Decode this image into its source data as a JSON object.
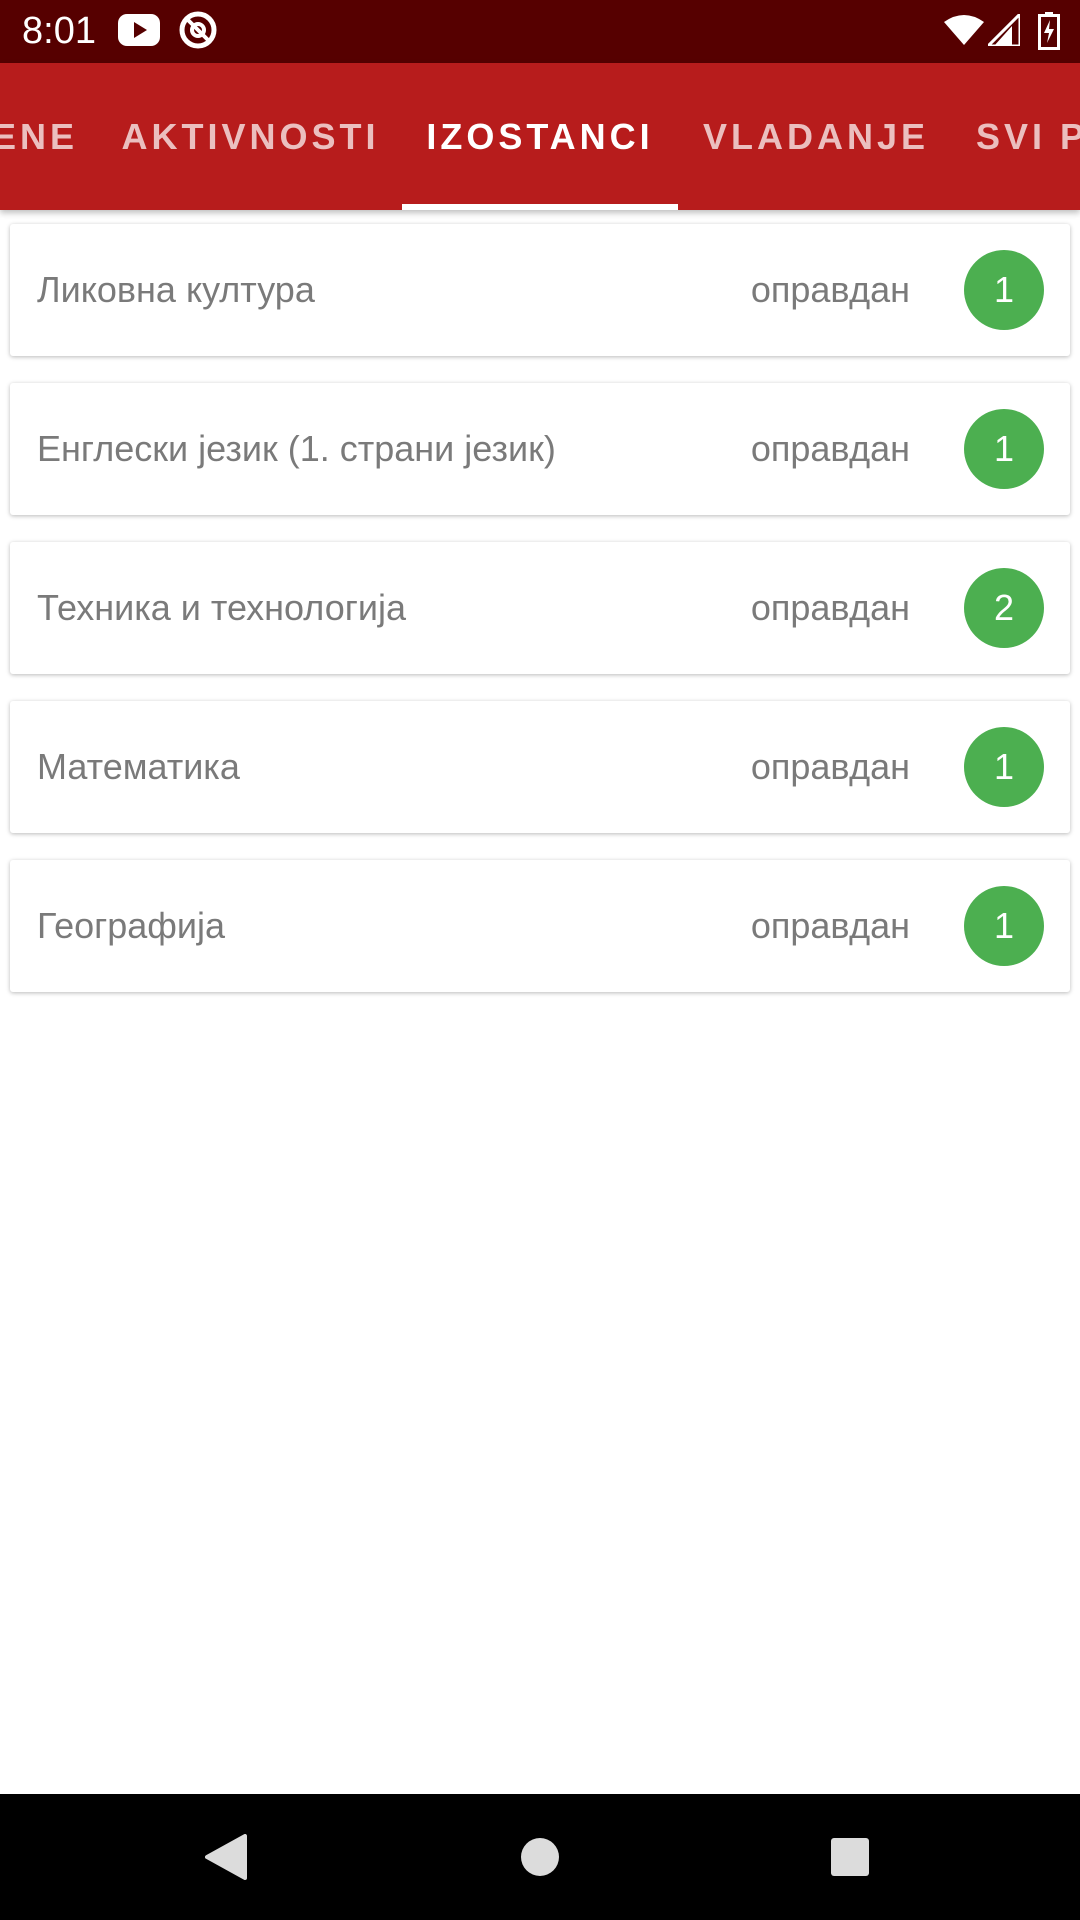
{
  "status_bar": {
    "time": "8:01",
    "left_icons": [
      "youtube-icon",
      "at-sign-icon"
    ],
    "right_icons": [
      "wifi-icon",
      "signal-icon",
      "battery-charging-icon"
    ]
  },
  "tabs": [
    {
      "label": "ENE",
      "active": false
    },
    {
      "label": "AKTIVNOSTI",
      "active": false
    },
    {
      "label": "IZOSTANCI",
      "active": true
    },
    {
      "label": "VLADANJE",
      "active": false
    },
    {
      "label": "SVI P",
      "active": false
    }
  ],
  "absences": [
    {
      "subject": "Ликовна култура",
      "status": "оправдан",
      "count": "1"
    },
    {
      "subject": "Енглески језик (1. страни језик)",
      "status": "оправдан",
      "count": "1"
    },
    {
      "subject": "Техника и технологија",
      "status": "оправдан",
      "count": "2"
    },
    {
      "subject": "Математика",
      "status": "оправдан",
      "count": "1"
    },
    {
      "subject": "Географија",
      "status": "оправдан",
      "count": "1"
    }
  ],
  "colors": {
    "status_bar": "#560000",
    "tab_bar": "#b71c1c",
    "badge": "#4caf50",
    "text_secondary": "#7a7a7a"
  },
  "nav_bar": {
    "icons": [
      "back-icon",
      "home-icon",
      "recents-icon"
    ]
  }
}
